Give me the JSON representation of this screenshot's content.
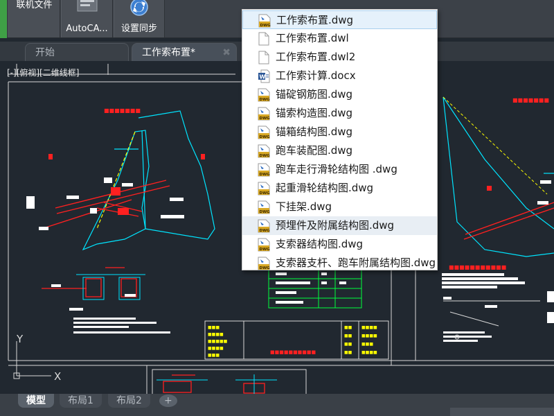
{
  "ribbon": {
    "buttons": [
      {
        "label": "联机文件",
        "icon": "cloud-file-icon"
      },
      {
        "label": "AutoCA...",
        "icon": "autocad-icon"
      },
      {
        "label": "设置同步",
        "icon": "sync-settings-icon"
      }
    ]
  },
  "tabs": [
    {
      "label": "开始"
    },
    {
      "label": "工作索布置*",
      "close": "✖"
    }
  ],
  "viewport_label": "[-][俯视][二维线框]",
  "axis": {
    "x": "X",
    "y": "Y"
  },
  "layout_tabs": [
    "模型",
    "布局1",
    "布局2",
    "+"
  ],
  "popup": {
    "items": [
      {
        "name": "工作索布置.dwg",
        "icon": "dwg-file-icon",
        "state": "selected"
      },
      {
        "name": "工作索布置.dwl",
        "icon": "blank-file-icon"
      },
      {
        "name": "工作索布置.dwl2",
        "icon": "blank-file-icon"
      },
      {
        "name": "工作索计算.docx",
        "icon": "word-file-icon"
      },
      {
        "name": "锚碇钢筋图.dwg",
        "icon": "dwg-file-icon"
      },
      {
        "name": "锚索构造图.dwg",
        "icon": "dwg-file-icon"
      },
      {
        "name": "锚箱结构图.dwg",
        "icon": "dwg-file-icon"
      },
      {
        "name": "跑车装配图.dwg",
        "icon": "dwg-file-icon"
      },
      {
        "name": "跑车走行滑轮结构图 .dwg",
        "icon": "dwg-file-icon"
      },
      {
        "name": "起重滑轮结构图.dwg",
        "icon": "dwg-file-icon"
      },
      {
        "name": "下挂架.dwg",
        "icon": "dwg-file-icon"
      },
      {
        "name": "预埋件及附属结构图.dwg",
        "icon": "dwg-file-icon",
        "state": "hover"
      },
      {
        "name": "支索器结构图.dwg",
        "icon": "dwg-file-icon"
      },
      {
        "name": "支索器支杆、跑车附属结构图.dwg",
        "icon": "dwg-file-icon"
      }
    ]
  },
  "colors": {
    "drawing_bg": "#212830",
    "cad_red": "#ff2020",
    "cad_cyan": "#00e5ff",
    "cad_green": "#00ff3c",
    "cad_yellow": "#ffff00"
  }
}
